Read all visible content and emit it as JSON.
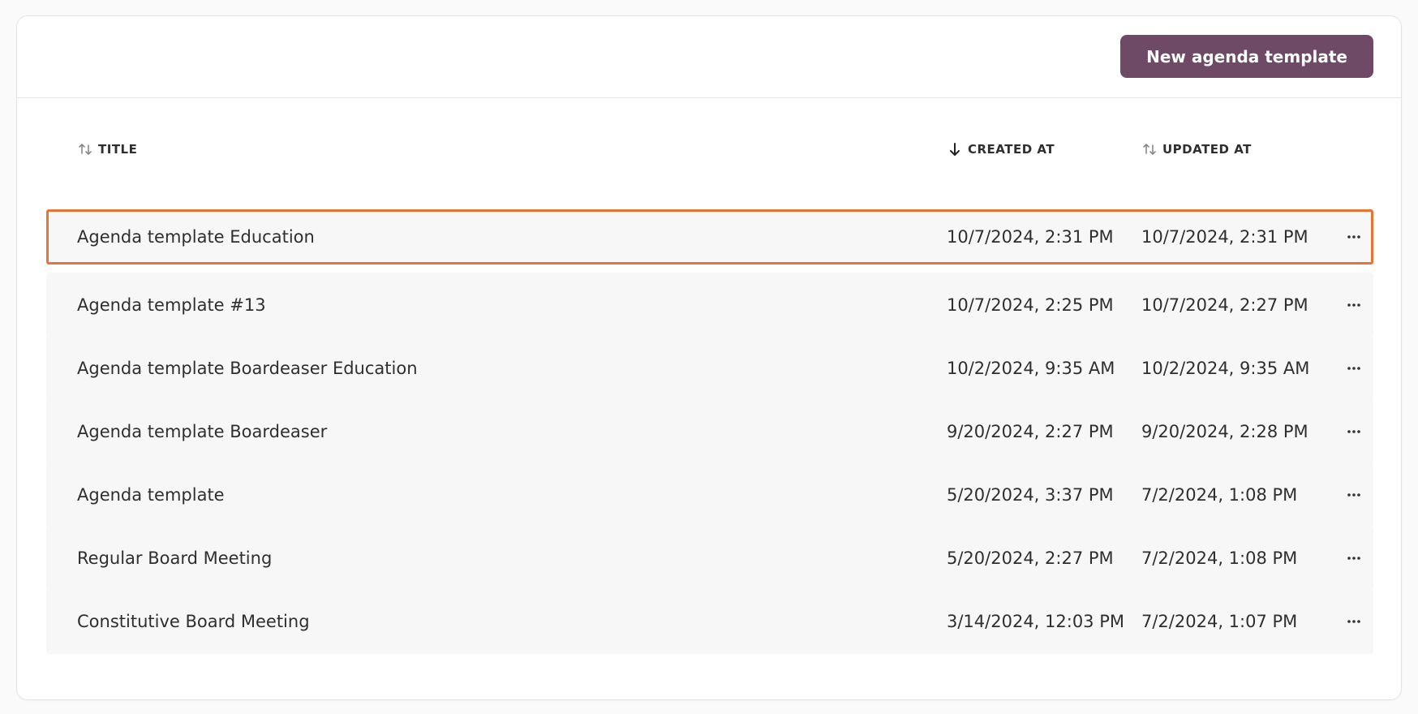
{
  "header": {
    "new_button_label": "New agenda template"
  },
  "columns": {
    "title": "TITLE",
    "created_at": "CREATED AT",
    "updated_at": "UPDATED AT"
  },
  "sort": {
    "title_icon": "sort-both-icon",
    "created_at_icon": "sort-desc-icon",
    "updated_at_icon": "sort-both-icon"
  },
  "rows": [
    {
      "title": "Agenda template Education",
      "created_at": "10/7/2024, 2:31 PM",
      "updated_at": "10/7/2024, 2:31 PM"
    },
    {
      "title": "Agenda template #13",
      "created_at": "10/7/2024, 2:25 PM",
      "updated_at": "10/7/2024, 2:27 PM"
    },
    {
      "title": "Agenda template Boardeaser Education",
      "created_at": "10/2/2024, 9:35 AM",
      "updated_at": "10/2/2024, 9:35 AM"
    },
    {
      "title": "Agenda template Boardeaser",
      "created_at": "9/20/2024, 2:27 PM",
      "updated_at": "9/20/2024, 2:28 PM"
    },
    {
      "title": "Agenda template",
      "created_at": "5/20/2024, 3:37 PM",
      "updated_at": "7/2/2024, 1:08 PM"
    },
    {
      "title": "Regular Board Meeting",
      "created_at": "5/20/2024, 2:27 PM",
      "updated_at": "7/2/2024, 1:08 PM"
    },
    {
      "title": "Constitutive Board Meeting",
      "created_at": "3/14/2024, 12:03 PM",
      "updated_at": "7/2/2024, 1:07 PM"
    }
  ],
  "row_action_icon": "more-horizontal-icon",
  "colors": {
    "primary_button": "#6e4a66",
    "selected_outline": "#e87535",
    "row_background": "#f7f7f7"
  }
}
